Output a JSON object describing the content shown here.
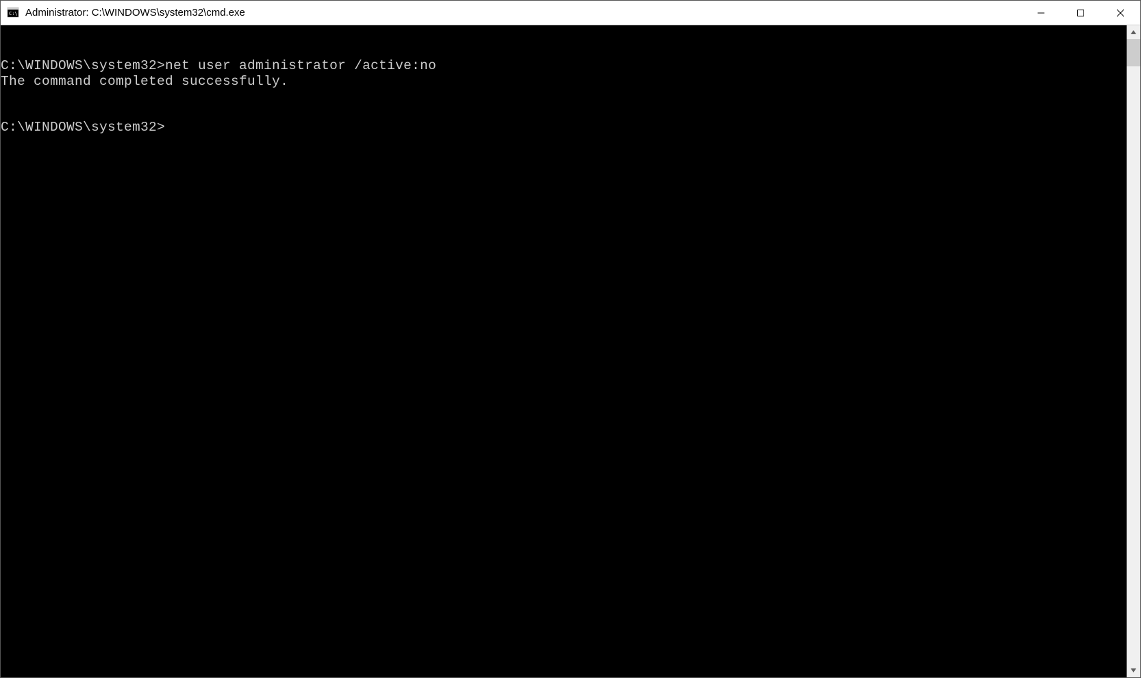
{
  "titlebar": {
    "title": "Administrator: C:\\WINDOWS\\system32\\cmd.exe"
  },
  "terminal": {
    "lines": [
      {
        "prompt": "C:\\WINDOWS\\system32>",
        "command": "net user administrator /active:no"
      },
      {
        "output": "The command completed successfully."
      },
      {
        "output": ""
      },
      {
        "output": ""
      },
      {
        "prompt": "C:\\WINDOWS\\system32>",
        "command": ""
      }
    ]
  }
}
